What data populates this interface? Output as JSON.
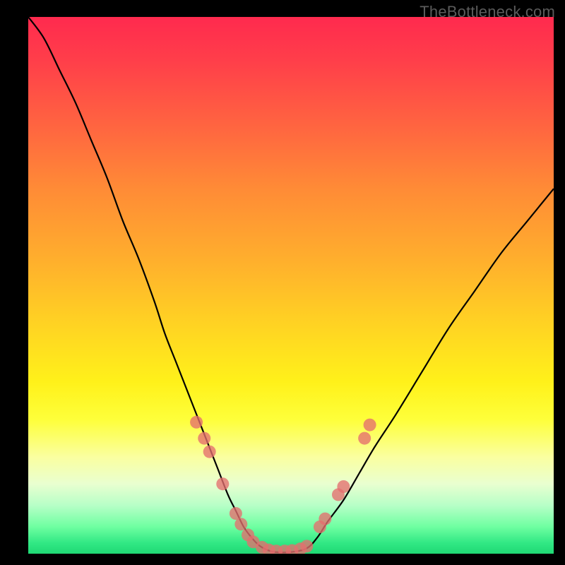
{
  "watermark": "TheBottleneck.com",
  "chart_data": {
    "type": "line",
    "title": "",
    "xlabel": "",
    "ylabel": "",
    "xlim": [
      0,
      100
    ],
    "ylim": [
      0,
      100
    ],
    "grid": false,
    "legend": false,
    "background": "rainbow-gradient",
    "series": [
      {
        "name": "bottleneck-curve",
        "color": "#000000",
        "x": [
          0,
          3,
          6,
          9,
          12,
          15,
          18,
          21,
          24,
          26,
          28,
          30,
          32,
          34,
          36,
          38,
          39.5,
          41,
          42.5,
          44,
          45.5,
          47,
          50,
          53,
          55,
          57,
          60,
          63,
          66,
          70,
          75,
          80,
          85,
          90,
          95,
          100
        ],
        "values": [
          100,
          96,
          90,
          84,
          77,
          70,
          62,
          55,
          47,
          41,
          36,
          31,
          26,
          21,
          16,
          11,
          8,
          5,
          3,
          1.5,
          0.7,
          0.3,
          0.3,
          1,
          3,
          6,
          10,
          15,
          20,
          26,
          34,
          42,
          49,
          56,
          62,
          68
        ]
      }
    ],
    "markers": [
      {
        "x": 32.0,
        "y": 24.5
      },
      {
        "x": 33.5,
        "y": 21.5
      },
      {
        "x": 34.5,
        "y": 19.0
      },
      {
        "x": 37.0,
        "y": 13.0
      },
      {
        "x": 39.5,
        "y": 7.5
      },
      {
        "x": 40.5,
        "y": 5.5
      },
      {
        "x": 41.8,
        "y": 3.5
      },
      {
        "x": 42.8,
        "y": 2.2
      },
      {
        "x": 44.5,
        "y": 1.2
      },
      {
        "x": 45.8,
        "y": 0.7
      },
      {
        "x": 47.2,
        "y": 0.5
      },
      {
        "x": 48.8,
        "y": 0.5
      },
      {
        "x": 50.2,
        "y": 0.6
      },
      {
        "x": 51.8,
        "y": 0.9
      },
      {
        "x": 53.0,
        "y": 1.4
      },
      {
        "x": 55.5,
        "y": 5.0
      },
      {
        "x": 56.5,
        "y": 6.5
      },
      {
        "x": 59.0,
        "y": 11.0
      },
      {
        "x": 60.0,
        "y": 12.5
      },
      {
        "x": 64.0,
        "y": 21.5
      },
      {
        "x": 65.0,
        "y": 24.0
      }
    ],
    "marker_style": {
      "color": "#e46e6e",
      "radius_px": 9,
      "opacity": 0.78
    }
  }
}
